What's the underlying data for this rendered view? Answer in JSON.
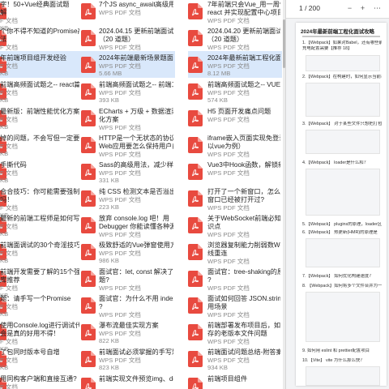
{
  "file_list": {
    "columns": [
      [
        {
          "l1": "字！50+Vue经典面试题",
          "l2": "解",
          "m1": "F 文档",
          "m2": "KB",
          "selected": false
        },
        {
          "l1": "个你不得不知道的Promise高",
          "l2": "法",
          "m1": "F 文档",
          "m2": "KB",
          "selected": false
        },
        {
          "l1": "年前端项目组开发经验",
          "l2": "",
          "m1": "F 文档",
          "m2": "KB",
          "selected": true
        },
        {
          "l1": "前端高频面试题之-- react篇",
          "l2": "",
          "m1": "F 文档",
          "m2": "KB",
          "selected": false
        },
        {
          "l1": "最新版：前端性能优化方案汇",
          "l2": "",
          "m1": "F 文档",
          "m2": "KB",
          "selected": false
        },
        {
          "l1": "掉的问题，不会写但一定要",
          "l2": "",
          "m1": "F 文档",
          "m2": "KB",
          "selected": false
        },
        {
          "l1": "手撕代码",
          "l2": "",
          "m1": "F 文档",
          "m2": "KB",
          "selected": false
        },
        {
          "l1": "合合技巧：你可能需要强制更",
          "l2": "吗！",
          "m1": "F 文档",
          "m2": "KB",
          "selected": false
        },
        {
          "l1": "最新的前端工程师是如何写代",
          "l2": "",
          "m1": "F 文档",
          "m2": "KB",
          "selected": false
        },
        {
          "l1": "前端面调试的30个奇淫技巧",
          "l2": "",
          "m1": "F 文档",
          "m2": "KB",
          "selected": false
        },
        {
          "l1": "前端开发需要了解的15个强大",
          "l2": "库推荐",
          "m1": "F 文档",
          "m2": "KB",
          "selected": false
        },
        {
          "l1": "题：请手写一个Promise",
          "l2": "",
          "m1": "F 文档",
          "m2": "KB",
          "selected": false
        },
        {
          "l1": "使用Console.log进行调试代",
          "l2": "会是真的好用不得！",
          "m1": "F 文档",
          "m2": "KB",
          "selected": false
        },
        {
          "l1": "了包同时版本号自增",
          "l2": "",
          "m1": "F 文档",
          "m2": "KB",
          "selected": false
        },
        {
          "l1": "用同构客户端和直接互通?",
          "l2": "",
          "m1": "F 文档",
          "m2": "KB",
          "selected": false
        }
      ],
      [
        {
          "l1": "7个JS async_await高级用法",
          "l2": "",
          "m1": "WPS PDF 文档",
          "m2": "",
          "selected": false
        },
        {
          "l1": "2024.04.15 更新前端面试问题总结",
          "l2": "（20 道题）",
          "m1": "WPS PDF 文档",
          "m2": "",
          "selected": false
        },
        {
          "l1": "2024年前端最新场景题面试攻略",
          "l2": "",
          "m1": "WPS PDF 文档",
          "m2": "5.66 MB",
          "selected": true
        },
        {
          "l1": "前端高频面试题之-- 前端工程化",
          "l2": "",
          "m1": "WPS PDF 文档",
          "m2": "393 KB",
          "selected": false
        },
        {
          "l1": "ECharts + 万级 + 数据渲染性能优",
          "l2": "化方案",
          "m1": "WPS PDF 文档",
          "m2": "",
          "selected": false
        },
        {
          "l1": "HTTP是一个无状态的协议。那么",
          "l2": "Web应用要怎么保持用户的登录...",
          "m1": "WPS PDF 文档",
          "m2": "",
          "selected": false
        },
        {
          "l1": "Sass的高级用法，减少样式冗余",
          "l2": "",
          "m1": "WPS PDF 文档",
          "m2": "331 KB",
          "selected": false
        },
        {
          "l1": "纯 CSS 检测文本是否溢出",
          "l2": "",
          "m1": "WPS PDF 文档",
          "m2": "223 KB",
          "selected": false
        },
        {
          "l1": "放弃 console.log 吧！用",
          "l2": "Debugger 你能读懂各种源码",
          "m1": "WPS PDF 文档",
          "m2": "",
          "selected": false
        },
        {
          "l1": "极致舒适的Vue弹窗使用方案",
          "l2": "",
          "m1": "WPS PDF 文档",
          "m2": "986 KB",
          "selected": false
        },
        {
          "l1": "面试官：let, const 解决了什么问",
          "l2": "题?",
          "m1": "WPS PDF 文档",
          "m2": "",
          "selected": false
        },
        {
          "l1": "面试官：为什么不用 index 做 key",
          "l2": "?",
          "m1": "WPS PDF 文档",
          "m2": "",
          "selected": false
        },
        {
          "l1": "瀑布流最佳实现方案",
          "l2": "",
          "m1": "WPS PDF 文档",
          "m2": "822 KB",
          "selected": false
        },
        {
          "l1": "前端面试必须掌握的手写题",
          "l2": "",
          "m1": "WPS PDF 文档",
          "m2": "823 KB",
          "selected": false
        },
        {
          "l1": "前端实现文件预览img、docx、",
          "l2": "",
          "m1": "",
          "m2": "",
          "selected": false
        }
      ],
      [
        {
          "l1": "7年前端只会Vue_用一周快速入门",
          "l2": "react 并实现配置中心项目",
          "m1": "WPS PDF 文档",
          "m2": "",
          "selected": false
        },
        {
          "l1": "2024.04.20 更新前端面试问题总结",
          "l2": "（20 道题）",
          "m1": "WPS PDF 文档",
          "m2": "",
          "selected": false
        },
        {
          "l1": "2024年最新前端工程化面试攻略",
          "l2": "",
          "m1": "WPS PDF 文档",
          "m2": "8.12 MB",
          "selected": true
        },
        {
          "l1": "前端高频面试题之-- VUE篇",
          "l2": "",
          "m1": "WPS PDF 文档",
          "m2": "574 KB",
          "selected": false
        },
        {
          "l1": "H5 页面开发痛点问题",
          "l2": "",
          "m1": "WPS PDF 文档",
          "m2": "",
          "selected": false
        },
        {
          "l1": "iframe嵌入页面实现免登录思路（",
          "l2": "以vue为例）",
          "m1": "WPS PDF 文档",
          "m2": "",
          "selected": false
        },
        {
          "l1": "Vue3中Hook函数，解锁新技能!",
          "l2": "",
          "m1": "WPS PDF 文档",
          "m2": "",
          "selected": false
        },
        {
          "l1": "打开了一个新窗口，怎么知道这个",
          "l2": "窗口已经被打开过?",
          "m1": "WPS PDF 文档",
          "m2": "",
          "selected": false
        },
        {
          "l1": "关于WebSocket前端必知必会的知",
          "l2": "识点",
          "m1": "WPS PDF 文档",
          "m2": "",
          "selected": false
        },
        {
          "l1": "浏览器复制能力削弱数Websocket断",
          "l2": "线重连",
          "m1": "WPS PDF 文档",
          "m2": "",
          "selected": false
        },
        {
          "l1": "面试官：tree-shaking的原理是什么",
          "l2": "?",
          "m1": "WPS PDF 文档",
          "m2": "",
          "selected": false
        },
        {
          "l1": "面试如何回答 JSON.stringify 的使",
          "l2": "用场景",
          "m1": "WPS PDF 文档",
          "m2": "",
          "selected": false
        },
        {
          "l1": "前端部署发布项目后，如何解决缓",
          "l2": "存的老版本文件问题",
          "m1": "WPS PDF 文档",
          "m2": "",
          "selected": false
        },
        {
          "l1": "前端面试问题总结-附答案",
          "l2": "",
          "m1": "WPS PDF 文档",
          "m2": "934 KB",
          "selected": false
        },
        {
          "l1": "前端项目组件",
          "l2": "",
          "m1": "",
          "m2": "",
          "selected": false
        }
      ]
    ]
  },
  "preview": {
    "page_indicator": "1 / 200",
    "title": "2024年最新前端工程化面试攻略",
    "lines": [
      "1.【Webpack】如果对Babel，还有哪些前端优化比较",
      "充电配置需要【推荐 18】",
      "2.【Webpack】在构建时，如何显示当前项目时间？",
      "3.【Webpack】 对于某些文件只想把打包发布？",
      "4.【Webpack】 loader是什么和？",
      "5.【Webpack】 plugins的原理，loader区别？",
      "6.【Webpack】 热更新(HMR)的原理是",
      "7.【Webpack】 如何优化构建速度？",
      "8. 【Webpack】如何将多个文件合并为一个多页面?",
      "9. 如何用 eslint 和 prettier配置项目",
      "10.【Vite】 vite 为什么那么快？"
    ]
  }
}
